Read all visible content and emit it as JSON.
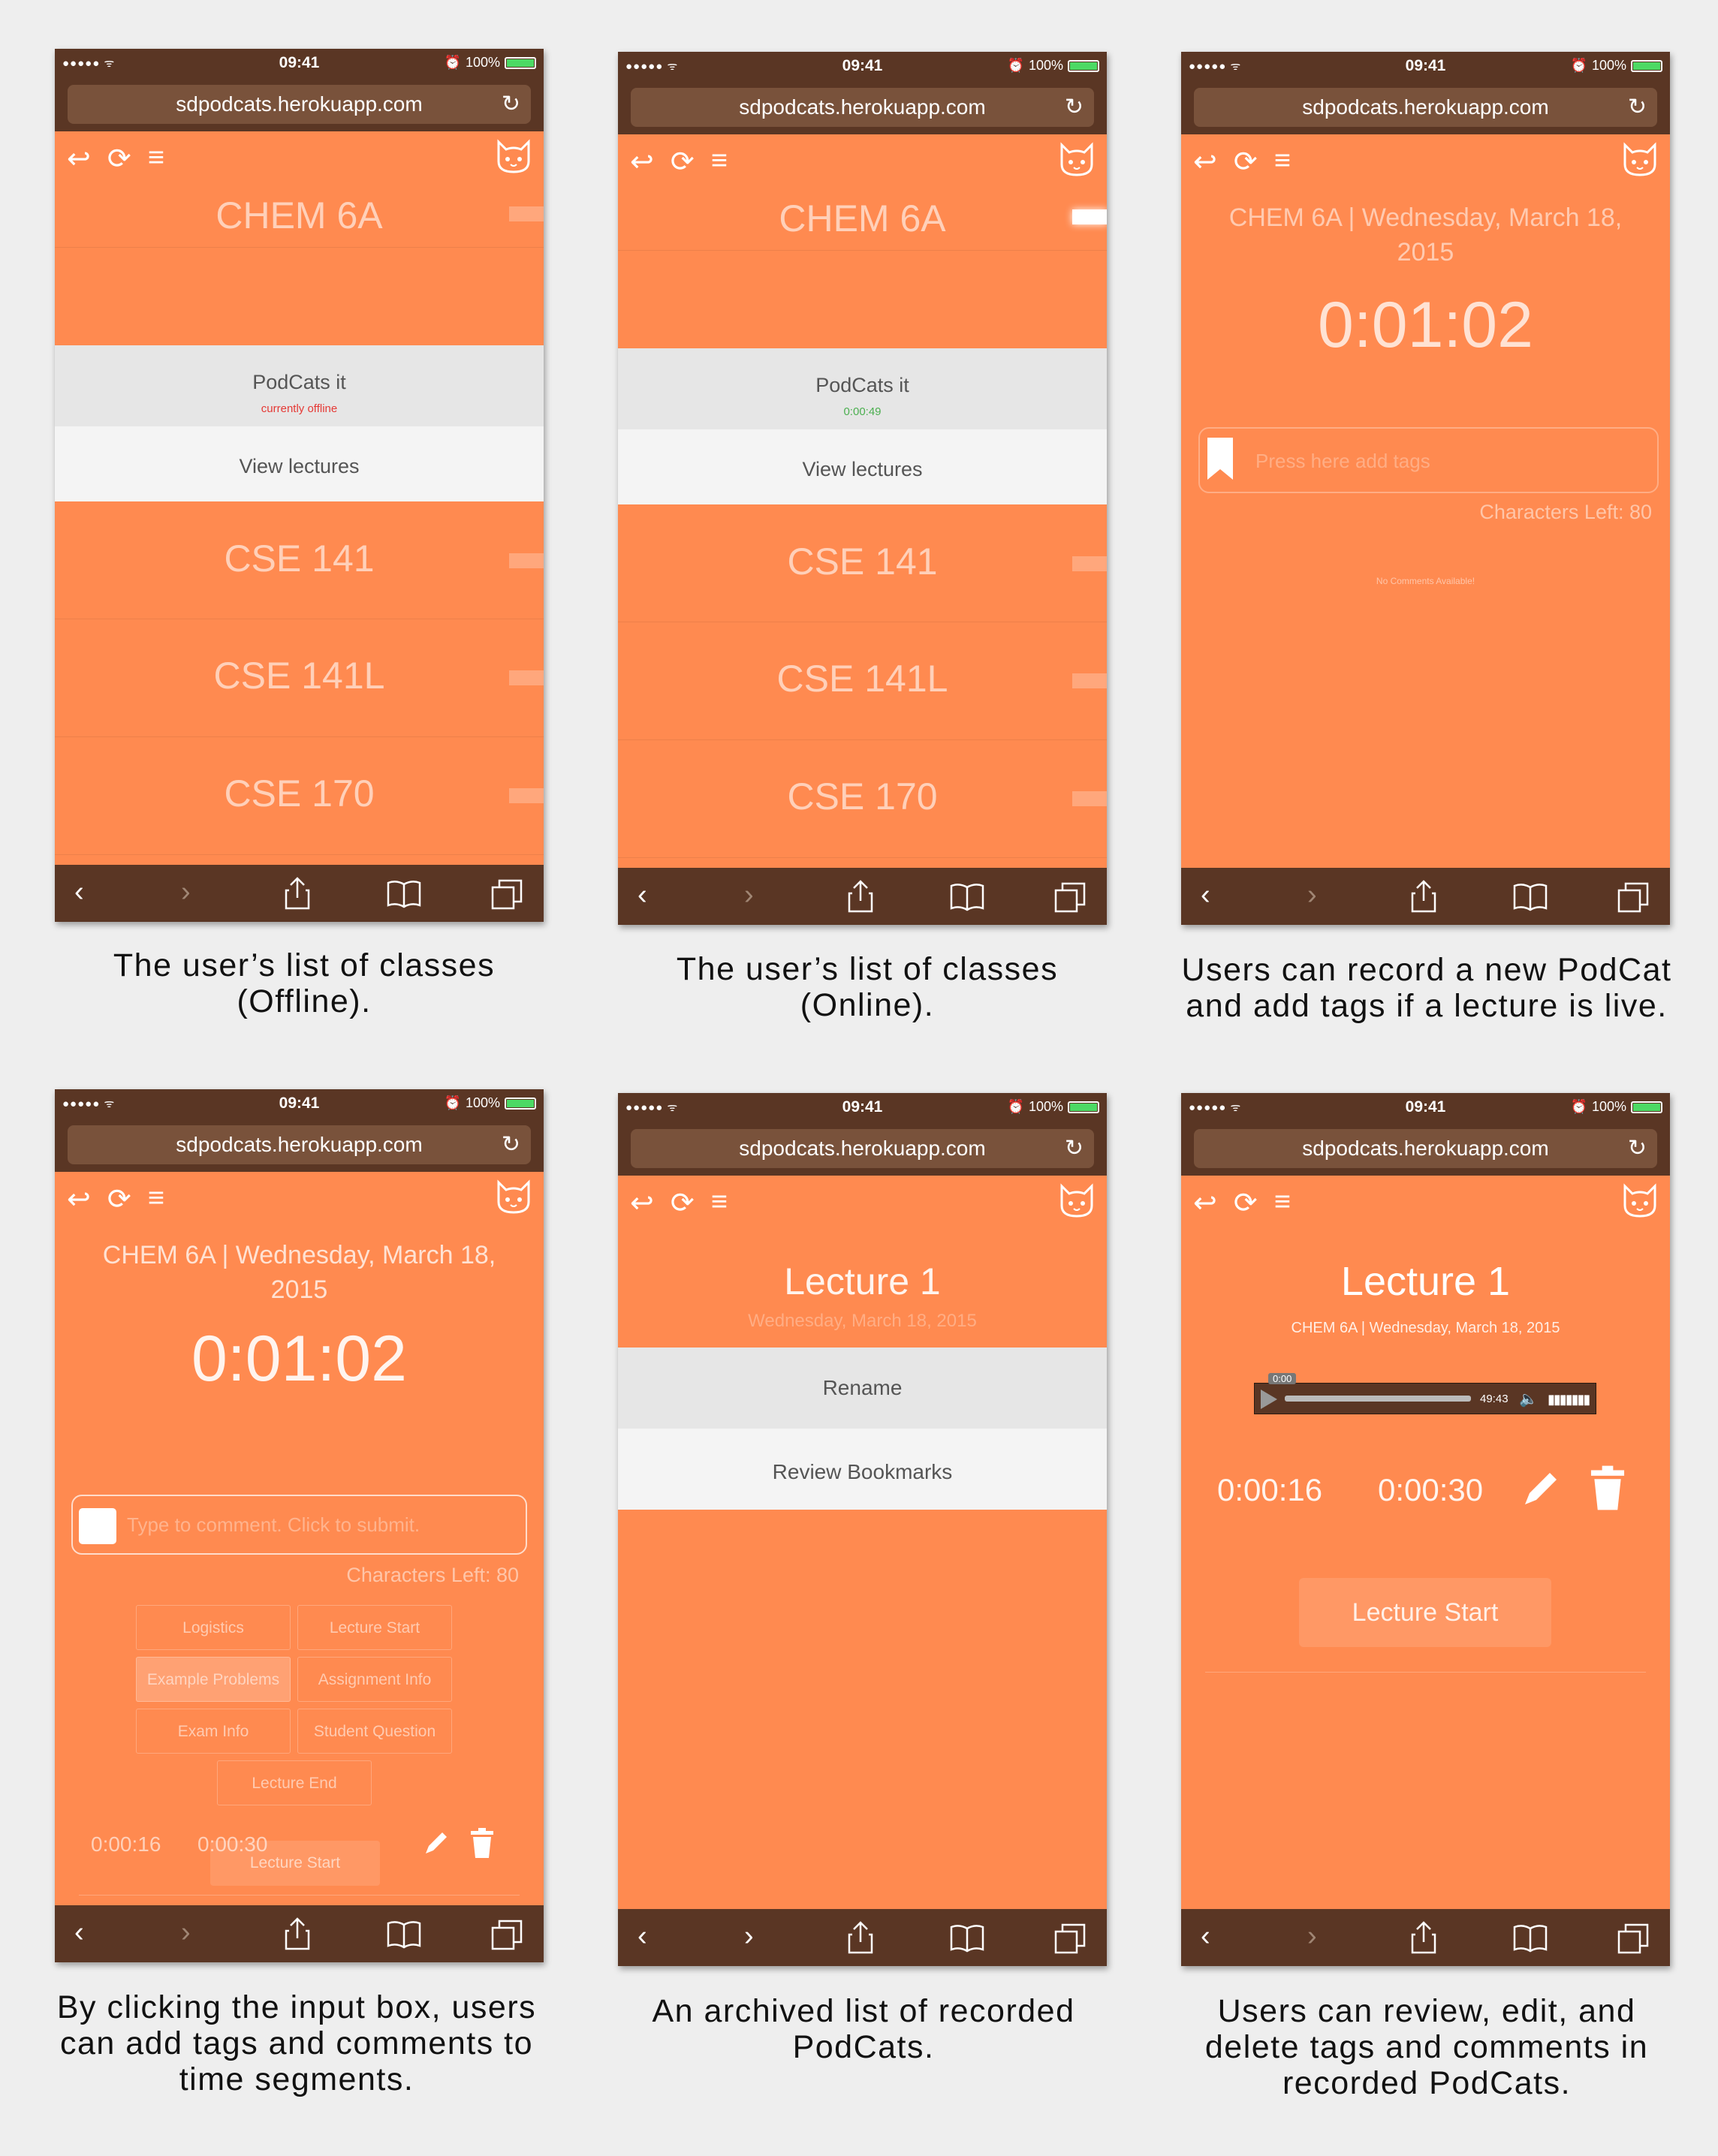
{
  "browser": {
    "status_signal": "●●●●● ᯤ",
    "status_time": "09:41",
    "status_battery": "100%",
    "url": "sdpodcats.herokuapp.com",
    "toolbar": [
      "‹",
      "›",
      "share-icon",
      "bookmarks-icon",
      "tabs-icon"
    ]
  },
  "colors": {
    "app_bg": "#ff8a50",
    "chrome": "#5a3624",
    "online_green": "#4caf50",
    "offline_red": "#e53935"
  },
  "screens": [
    {
      "caption": "The user’s list of classes (Offline).",
      "courses": [
        "CHEM 6A",
        "CSE 141",
        "CSE 141L",
        "CSE 170"
      ],
      "podcats_label": "PodCats it",
      "podcats_status": "currently offline",
      "view_label": "View lectures"
    },
    {
      "caption": "The user’s list of classes (Online).",
      "courses": [
        "CHEM 6A",
        "CSE 141",
        "CSE 141L",
        "CSE 170"
      ],
      "podcats_label": "PodCats it",
      "podcats_status": "0:00:49",
      "view_label": "View lectures"
    },
    {
      "caption_line1": "Users can record a new PodCat",
      "caption_line2": "and add tags if a lecture is live.",
      "heading_line1": "CHEM 6A | Wednesday, March 18,",
      "heading_line2": "2015",
      "timer": "0:01:02",
      "tag_placeholder": "Press here add tags",
      "chars_left": "Characters Left: 80",
      "no_comments": "No Comments Available!"
    },
    {
      "caption_line1": "By clicking the input box, users",
      "caption_line2": "can add tags and comments to",
      "caption_line3": "time segments.",
      "heading_line1": "CHEM 6A | Wednesday, March 18,",
      "heading_line2": "2015",
      "timer": "0:01:02",
      "comment_placeholder": "Type to comment. Click to submit.",
      "chars_left": "Characters Left: 80",
      "tags": [
        "Logistics",
        "Lecture Start",
        "Example Problems",
        "Assignment Info",
        "Exam Info",
        "Student Question",
        "Lecture End"
      ],
      "seg_start": "0:00:16",
      "seg_end": "0:00:30",
      "seg_tag": "Lecture Start"
    },
    {
      "caption_line1": "An archived list of recorded",
      "caption_line2": "PodCats.",
      "lecture_title": "Lecture 1",
      "lecture_date": "Wednesday, March 18, 2015",
      "rename_label": "Rename",
      "review_label": "Review Bookmarks"
    },
    {
      "caption_line1": "Users can review, edit, and",
      "caption_line2": "delete tags and comments in",
      "caption_line3": "recorded PodCats.",
      "lecture_title": "Lecture 1",
      "lecture_sub": "CHEM 6A | Wednesday, March 18, 2015",
      "audio_pos": "0:00",
      "audio_duration": "49:43",
      "seg_start": "0:00:16",
      "seg_end": "0:00:30",
      "seg_tag": "Lecture Start"
    }
  ]
}
